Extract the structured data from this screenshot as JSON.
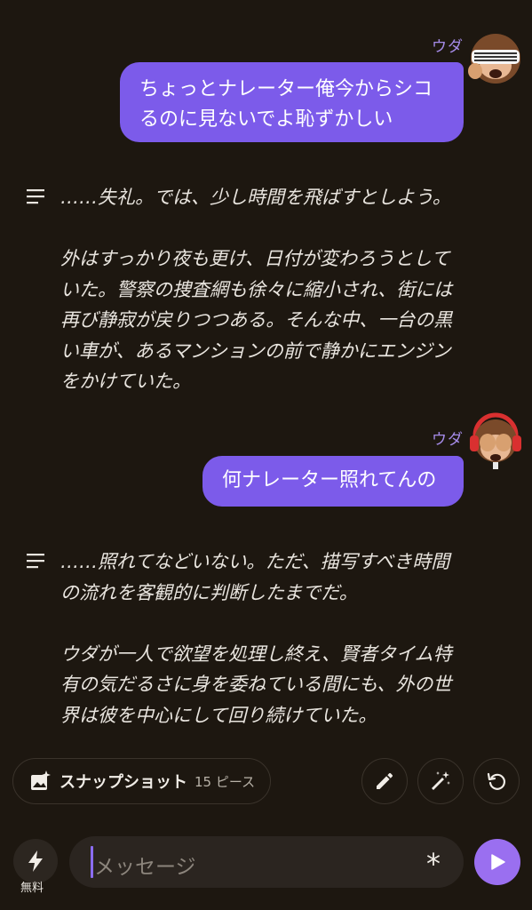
{
  "messages": [
    {
      "sender": "ウダ",
      "avatar_icon": "monkey-with-shutter-shades-icon",
      "text": "ちょっとナレーター俺今からシコ\nるのに見ないでよ恥ずかしい"
    },
    {
      "narration_icon": "narration-lines-icon",
      "text": "……失礼。では、少し時間を飛ばすとしよう。\n\n外はすっかり夜も更け、日付が変わろうとして\nいた。警察の捜査網も徐々に縮小され、街には\n再び静寂が戻りつつある。そんな中、一台の黒\nい車が、あるマンションの前で静かにエンジン\nをかけていた。"
    },
    {
      "sender": "ウダ",
      "avatar_icon": "see-no-evil-monkey-with-headphones-icon",
      "text": "何ナレーター照れてんの"
    },
    {
      "narration_icon": "narration-lines-icon",
      "text": "……照れてなどいない。ただ、描写すべき時間\nの流れを客観的に判断したまでだ。\n\nウダが一人で欲望を処理し終え、賢者タイム特\n有の気だるさに身を委ねている間にも、外の世\n界は彼を中心にして回り続けていた。"
    }
  ],
  "toolbar": {
    "snapshot_label": "スナップショット",
    "snapshot_count": "15 ピース",
    "edit_icon": "pencil-icon",
    "magic_icon": "magic-wand-icon",
    "regenerate_icon": "refresh-icon"
  },
  "composer": {
    "boost_label": "無料",
    "placeholder": "メッセージ",
    "asterisk": "*",
    "send_icon": "play-icon"
  },
  "colors": {
    "background": "#1d1710",
    "bubble": "#7c5bea",
    "sender": "#a58be8",
    "send_button": "#9a6ff0"
  }
}
